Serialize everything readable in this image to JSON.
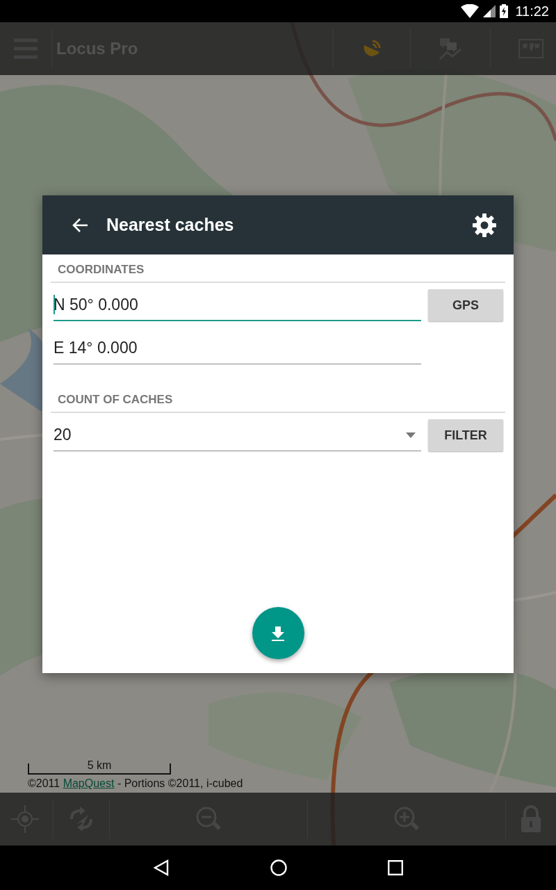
{
  "status_bar": {
    "time": "11:22"
  },
  "toolbar": {
    "title": "Locus Pro"
  },
  "map": {
    "scale": "5 km",
    "attribution": {
      "before": "©2011 ",
      "link": "MapQuest",
      "after": " - Portions ©2011, i-cubed"
    }
  },
  "dialog": {
    "title": "Nearest caches",
    "sections": [
      {
        "heading": "COORDINATES",
        "rows": [
          {
            "kind": "text",
            "value": "N 50° 0.000",
            "focused": true,
            "button": "GPS"
          },
          {
            "kind": "text",
            "value": "E 14° 0.000",
            "focused": false
          }
        ]
      },
      {
        "heading": "COUNT OF CACHES",
        "rows": [
          {
            "kind": "dropdown",
            "value": "20",
            "focused": false,
            "button": "FILTER"
          }
        ]
      }
    ]
  }
}
